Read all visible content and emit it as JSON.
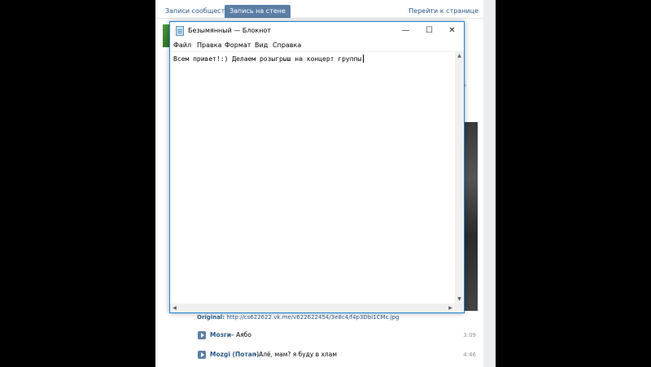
{
  "vk": {
    "tabs": [
      {
        "label": "Записи сообщества"
      },
      {
        "label": "Запись на стене"
      }
    ],
    "go_to_page": "Перейти к странице",
    "original_label": "Original:",
    "original_link": "http://cs622622.vk.me/v622622454/3e8c4/f4p3Dbi1CMc.jpg",
    "tracks": [
      {
        "artist": "Мозги",
        "title": " – Аябо",
        "duration": "3:09"
      },
      {
        "artist": "Mozgi (Потап)",
        "title": " – Алё, мам? я буду в хлам",
        "duration": "4:46"
      }
    ]
  },
  "notepad": {
    "title": "Безымянный — Блокнот",
    "menu": [
      "Файл",
      "Правка",
      "Формат",
      "Вид",
      "Справка"
    ],
    "content": "Всем привет!:) Делаем розыгрыш на концерт группы",
    "controls": {
      "minimize": "—",
      "maximize": "☐",
      "close": "✕"
    },
    "icons": {
      "app": "notepad-icon",
      "scroll_up": "▲",
      "scroll_down": "▼",
      "scroll_left": "◀",
      "scroll_right": "▶"
    }
  }
}
